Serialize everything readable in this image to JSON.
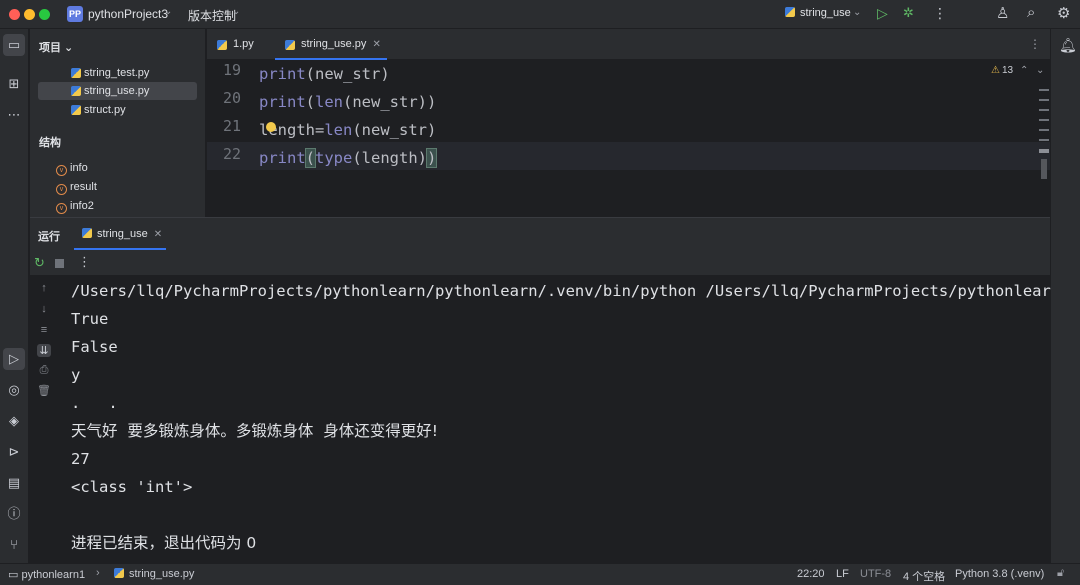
{
  "titlebar": {
    "project_badge": "PP",
    "project_name": "pythonProject3",
    "vcs": "版本控制",
    "run_config": "string_use"
  },
  "project_panel": {
    "title": "项目",
    "files": [
      "string_test.py",
      "string_use.py",
      "struct.py"
    ],
    "selected_file": "string_use.py",
    "structure_title": "结构",
    "structure_items": [
      "info",
      "result",
      "info2"
    ]
  },
  "editor": {
    "tabs": [
      {
        "label": "1.py",
        "active": false
      },
      {
        "label": "string_use.py",
        "active": true
      }
    ],
    "line_numbers": [
      "19",
      "20",
      "21",
      "22"
    ],
    "code": [
      {
        "fn": "print",
        "rest": "(new_str)"
      },
      {
        "fn": "print",
        "open": "(",
        "fn2": "len",
        "rest": "(new_str))"
      },
      {
        "lhs": "length",
        "op": "=",
        "fn": "len",
        "rest": "(new_str)"
      },
      {
        "fn": "print",
        "open": "(",
        "fn2": "type",
        "rest": "(length)",
        "close": ")"
      }
    ],
    "warning_count": "13"
  },
  "run_panel": {
    "title": "运行",
    "tab": "string_use",
    "output": [
      "/Users/llq/PycharmProjects/pythonlearn/pythonlearn/.venv/bin/python /Users/llq/PycharmProjects/pythonlear",
      "True",
      "False",
      "y",
      ".   .",
      "天气好  要多锻炼身体。多锻炼身体  身体还变得更好!",
      "27",
      "<class 'int'>",
      "",
      "进程已结束，退出代码为 0"
    ]
  },
  "statusbar": {
    "project": "pythonlearn1",
    "file": "string_use.py",
    "position": "22:20",
    "line_sep": "LF",
    "encoding": "UTF-8",
    "indent": "4 个空格",
    "interpreter": "Python 3.8 (.venv)"
  },
  "colors": {
    "accent": "#3574f0",
    "run_green": "#5fb865",
    "function": "#8888c6",
    "background": "#1e1f22",
    "panel": "#2b2d30"
  }
}
